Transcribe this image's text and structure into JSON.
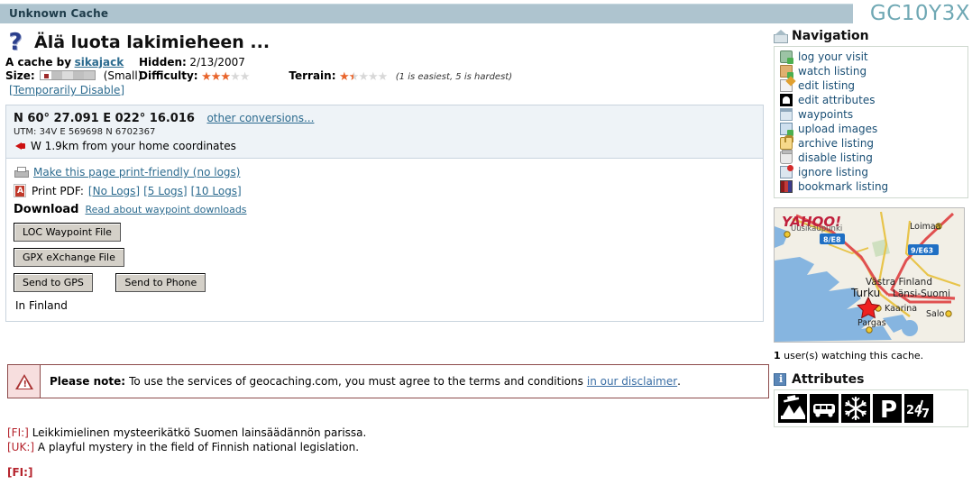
{
  "header": {
    "cache_type": "Unknown Cache",
    "gc_code": "GC10Y3X",
    "bar_color": "#aec4cf",
    "gc_color": "#6fa8b4"
  },
  "cache": {
    "title": "Älä luota lakimieheen ...",
    "type_icon": "question-mark-icon",
    "owner_prefix": "A cache by",
    "owner": "sikajack",
    "hidden_label": "Hidden:",
    "hidden_date": "2/13/2007",
    "size_label": "Size:",
    "size_value": "(Small)",
    "size_level": 2,
    "temporarily_disable": "[Temporarily Disable]",
    "difficulty_label": "Difficulty:",
    "difficulty": 3,
    "terrain_label": "Terrain:",
    "terrain": 1.5,
    "rating_hint": "(1 is easiest, 5 is hardest)"
  },
  "coordinates": {
    "primary": "N 60° 27.091 E 022° 16.016",
    "other_conversions": "other conversions...",
    "utm": "UTM: 34V E 569698 N 6702367",
    "distance": "W 1.9km from your home coordinates"
  },
  "tools": {
    "print_friendly": "Make this page print-friendly (no logs)",
    "print_pdf_label": "Print PDF:",
    "pdf_links": [
      "[No Logs]",
      "[5 Logs]",
      "[10 Logs]"
    ],
    "download_title": "Download",
    "download_read": "Read about waypoint downloads",
    "buttons": [
      "LOC Waypoint File",
      "GPX eXchange File",
      "Send to GPS",
      "Send to Phone"
    ],
    "location": "In Finland"
  },
  "notice": {
    "icon": "warning-triangle-icon",
    "bold": "Please note:",
    "text": "To use the services of geocaching.com, you must agree to the terms and conditions",
    "link": "in our disclaimer",
    "tail": ".",
    "border_color": "#8d4b4b"
  },
  "description": {
    "lines": [
      {
        "tag": "[FI:]",
        "text": "Leikkimielinen mysteerikätkö Suomen lainsäädännön parissa."
      },
      {
        "tag": "[UK:]",
        "text": "A playful mystery in the field of Finnish national legislation."
      }
    ],
    "section_tag": "[FI:]",
    "tag_color": "#b5232c"
  },
  "navigation": {
    "title": "Navigation",
    "title_icon": "home-icon",
    "items": [
      {
        "label": "log your visit",
        "icon": "log-visit-icon"
      },
      {
        "label": "watch listing",
        "icon": "watch-icon"
      },
      {
        "label": "edit listing",
        "icon": "edit-icon"
      },
      {
        "label": "edit attributes",
        "icon": "attributes-icon"
      },
      {
        "label": "waypoints",
        "icon": "waypoints-icon"
      },
      {
        "label": "upload images",
        "icon": "upload-image-icon"
      },
      {
        "label": "archive listing",
        "icon": "lock-icon"
      },
      {
        "label": "disable listing",
        "icon": "trash-icon"
      },
      {
        "label": "ignore listing",
        "icon": "ignore-icon"
      },
      {
        "label": "bookmark listing",
        "icon": "bookmark-icon"
      }
    ]
  },
  "map": {
    "provider": "YAHOO!",
    "marker": "red-star-marker",
    "labels": [
      "Loimaa",
      "Turku",
      "Västra Finland",
      "Länsi-Suomi",
      "Kaarina",
      "Salo",
      "Pargas",
      "Uusikaupunki"
    ],
    "road_shields": [
      "8/E8",
      "9/E63"
    ]
  },
  "watchers": {
    "count": "1",
    "text": "user(s) watching this cache."
  },
  "attributes": {
    "title": "Attributes",
    "title_icon": "info-icon",
    "items": [
      {
        "name": "scenic-view-icon",
        "label": "scenic view"
      },
      {
        "name": "public-transportation-icon",
        "label": "public transportation"
      },
      {
        "name": "winter-icon",
        "label": "available during winter"
      },
      {
        "name": "parking-available-icon",
        "label": "parking available"
      },
      {
        "name": "available-24-7-icon",
        "label": "24/7"
      }
    ],
    "badge_24_7": "24/7"
  }
}
